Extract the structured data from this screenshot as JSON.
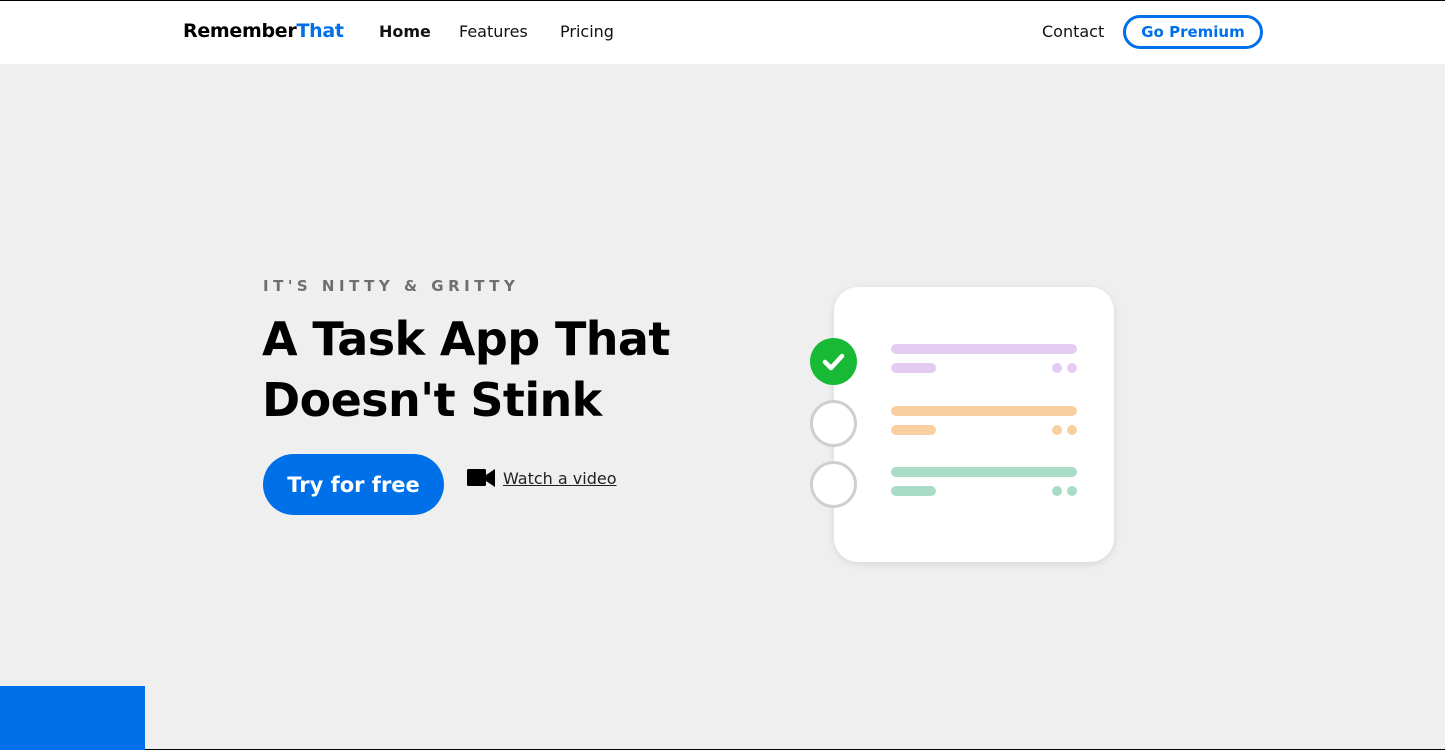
{
  "header": {
    "logo_part1": "Remember",
    "logo_part2": "That",
    "nav": {
      "home": "Home",
      "features": "Features",
      "pricing": "Pricing",
      "contact": "Contact"
    },
    "premium_label": "Go Premium"
  },
  "hero": {
    "eyebrow": "IT'S NITTY & GRITTY",
    "title": "A Task App That Doesn't Stink",
    "cta_label": "Try for free",
    "video_label": "Watch a video",
    "video_icon": "video-camera-icon"
  },
  "illustration": {
    "tasks": [
      {
        "completed": true,
        "color": "#e4cbf1"
      },
      {
        "completed": false,
        "color": "#f9cfa2"
      },
      {
        "completed": false,
        "color": "#a9dcc6"
      }
    ]
  },
  "colors": {
    "accent": "#0070e8",
    "success": "#17b935",
    "hero_bg": "#efefef",
    "header_bg": "#ffffff"
  }
}
